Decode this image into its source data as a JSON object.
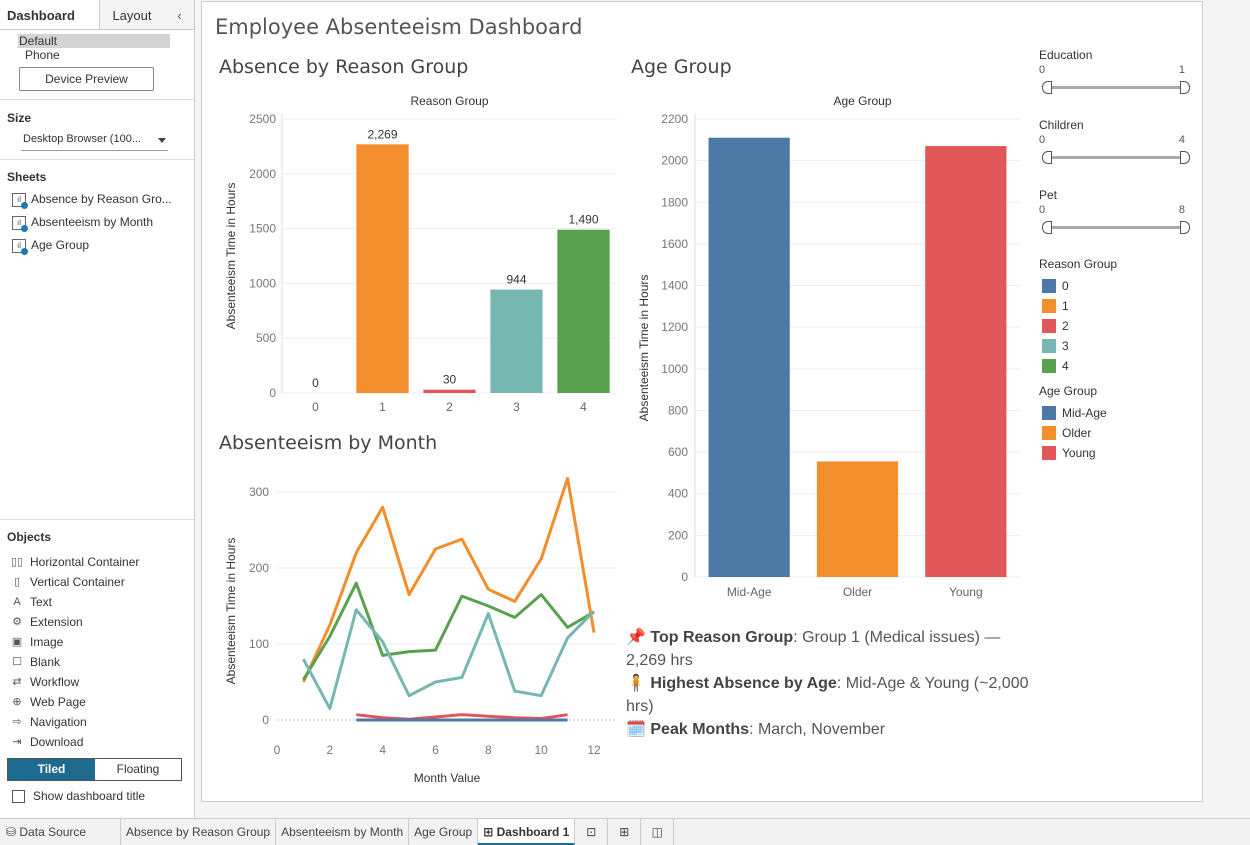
{
  "panel": {
    "tab_dashboard": "Dashboard",
    "tab_layout": "Layout",
    "collapse": "‹",
    "device_default": "Default",
    "device_phone": "Phone",
    "device_preview": "Device Preview",
    "size_title": "Size",
    "size_value": "Desktop Browser (100...",
    "sheets_title": "Sheets",
    "sheets": [
      "Absence by Reason Gro...",
      "Absenteeism by Month",
      "Age Group"
    ],
    "objects_title": "Objects",
    "objects": [
      {
        "label": "Horizontal Container",
        "icon": "▯▯"
      },
      {
        "label": "Vertical Container",
        "icon": "▯"
      },
      {
        "label": "Text",
        "icon": "A"
      },
      {
        "label": "Extension",
        "icon": "⚙"
      },
      {
        "label": "Image",
        "icon": "▣"
      },
      {
        "label": "Blank",
        "icon": "☐"
      },
      {
        "label": "Workflow",
        "icon": "⇄"
      },
      {
        "label": "Web Page",
        "icon": "⊕"
      },
      {
        "label": "Navigation",
        "icon": "⇨"
      },
      {
        "label": "Download",
        "icon": "⇥"
      }
    ],
    "tiled": "Tiled",
    "floating": "Floating",
    "show_title": "Show dashboard title"
  },
  "dashboard": {
    "title": "Employee Absenteeism Dashboard",
    "reason_title": "Absence by Reason Group",
    "month_title": "Absenteeism by Month",
    "age_title": "Age Group"
  },
  "filters": [
    {
      "name": "Education",
      "min": "0",
      "max": "1"
    },
    {
      "name": "Children",
      "min": "0",
      "max": "4"
    },
    {
      "name": "Pet",
      "min": "0",
      "max": "8"
    }
  ],
  "legends": {
    "reason_title": "Reason Group",
    "reason_items": [
      {
        "label": "0",
        "color": "#4e79a7"
      },
      {
        "label": "1",
        "color": "#f28e2b"
      },
      {
        "label": "2",
        "color": "#e15759"
      },
      {
        "label": "3",
        "color": "#76b7b2"
      },
      {
        "label": "4",
        "color": "#59a14f"
      }
    ],
    "age_title": "Age Group",
    "age_items": [
      {
        "label": "Mid-Age",
        "color": "#4e79a7"
      },
      {
        "label": "Older",
        "color": "#f28e2b"
      },
      {
        "label": "Young",
        "color": "#e15759"
      }
    ]
  },
  "insights": [
    {
      "emoji": "📌",
      "bold": "Top Reason Group",
      "text": ": Group 1 (Medical issues) — 2,269 hrs"
    },
    {
      "emoji": "🧍",
      "bold": "Highest Absence by Age",
      "text": ": Mid-Age & Young (~2,000 hrs)"
    },
    {
      "emoji": "🗓️",
      "bold": "Peak Months",
      "text": ": March, November"
    }
  ],
  "bottom_tabs": {
    "data_source": "Data Source",
    "sheets": [
      "Absence by Reason Group",
      "Absenteeism by Month",
      "Age Group"
    ],
    "active": "Dashboard 1"
  },
  "chart_data": [
    {
      "type": "bar",
      "header": "Reason Group",
      "categories": [
        "0",
        "1",
        "2",
        "3",
        "4"
      ],
      "values": [
        0,
        2269,
        30,
        944,
        1490
      ],
      "labels": [
        "0",
        "2,269",
        "30",
        "944",
        "1,490"
      ],
      "colors": [
        "#4e79a7",
        "#f28e2b",
        "#e15759",
        "#76b7b2",
        "#59a14f"
      ],
      "ylabel": "Absenteeism Time in Hours",
      "ylim": [
        0,
        2500
      ],
      "yticks": [
        0,
        500,
        1000,
        1500,
        2000,
        2500
      ]
    },
    {
      "type": "line",
      "xlabel": "Month Value",
      "ylabel": "Absenteeism Time in Hours",
      "xlim": [
        0,
        12
      ],
      "xticks": [
        0,
        2,
        4,
        6,
        8,
        10,
        12
      ],
      "ylim": [
        0,
        300
      ],
      "yticks": [
        0,
        100,
        200,
        300
      ],
      "series": [
        {
          "color": "#f28e2b",
          "points": [
            [
              1,
              50
            ],
            [
              2,
              125
            ],
            [
              3,
              220
            ],
            [
              4,
              280
            ],
            [
              5,
              165
            ],
            [
              6,
              225
            ],
            [
              7,
              238
            ],
            [
              8,
              172
            ],
            [
              9,
              156
            ],
            [
              10,
              212
            ],
            [
              11,
              318
            ],
            [
              12,
              115
            ]
          ]
        },
        {
          "color": "#59a14f",
          "points": [
            [
              1,
              53
            ],
            [
              2,
              110
            ],
            [
              3,
              180
            ],
            [
              4,
              85
            ],
            [
              5,
              90
            ],
            [
              6,
              92
            ],
            [
              7,
              163
            ],
            [
              8,
              150
            ],
            [
              9,
              135
            ],
            [
              10,
              165
            ],
            [
              11,
              122
            ],
            [
              12,
              142
            ]
          ]
        },
        {
          "color": "#76b7b2",
          "points": [
            [
              1,
              80
            ],
            [
              2,
              15
            ],
            [
              3,
              145
            ],
            [
              4,
              103
            ],
            [
              5,
              32
            ],
            [
              6,
              50
            ],
            [
              7,
              56
            ],
            [
              8,
              140
            ],
            [
              9,
              38
            ],
            [
              10,
              32
            ],
            [
              11,
              108
            ],
            [
              12,
              143
            ]
          ]
        },
        {
          "color": "#e15759",
          "points": [
            [
              3,
              7
            ],
            [
              4,
              3
            ],
            [
              5,
              1
            ],
            [
              6,
              4
            ],
            [
              7,
              7
            ],
            [
              8,
              5
            ],
            [
              9,
              3
            ],
            [
              10,
              2
            ],
            [
              11,
              7
            ]
          ]
        },
        {
          "color": "#4e79a7",
          "points": [
            [
              3,
              0
            ],
            [
              4,
              0
            ],
            [
              5,
              0
            ],
            [
              6,
              0
            ],
            [
              7,
              0
            ],
            [
              8,
              0
            ],
            [
              9,
              0
            ],
            [
              10,
              0
            ],
            [
              11,
              0
            ]
          ]
        }
      ]
    },
    {
      "type": "bar",
      "header": "Age Group",
      "categories": [
        "Mid-Age",
        "Older",
        "Young"
      ],
      "values": [
        2110,
        555,
        2070
      ],
      "colors": [
        "#4e79a7",
        "#f28e2b",
        "#e15759"
      ],
      "ylabel": "Absenteeism Time in Hours",
      "ylim": [
        0,
        2200
      ],
      "yticks": [
        0,
        200,
        400,
        600,
        800,
        1000,
        1200,
        1400,
        1600,
        1800,
        2000,
        2200
      ]
    }
  ]
}
